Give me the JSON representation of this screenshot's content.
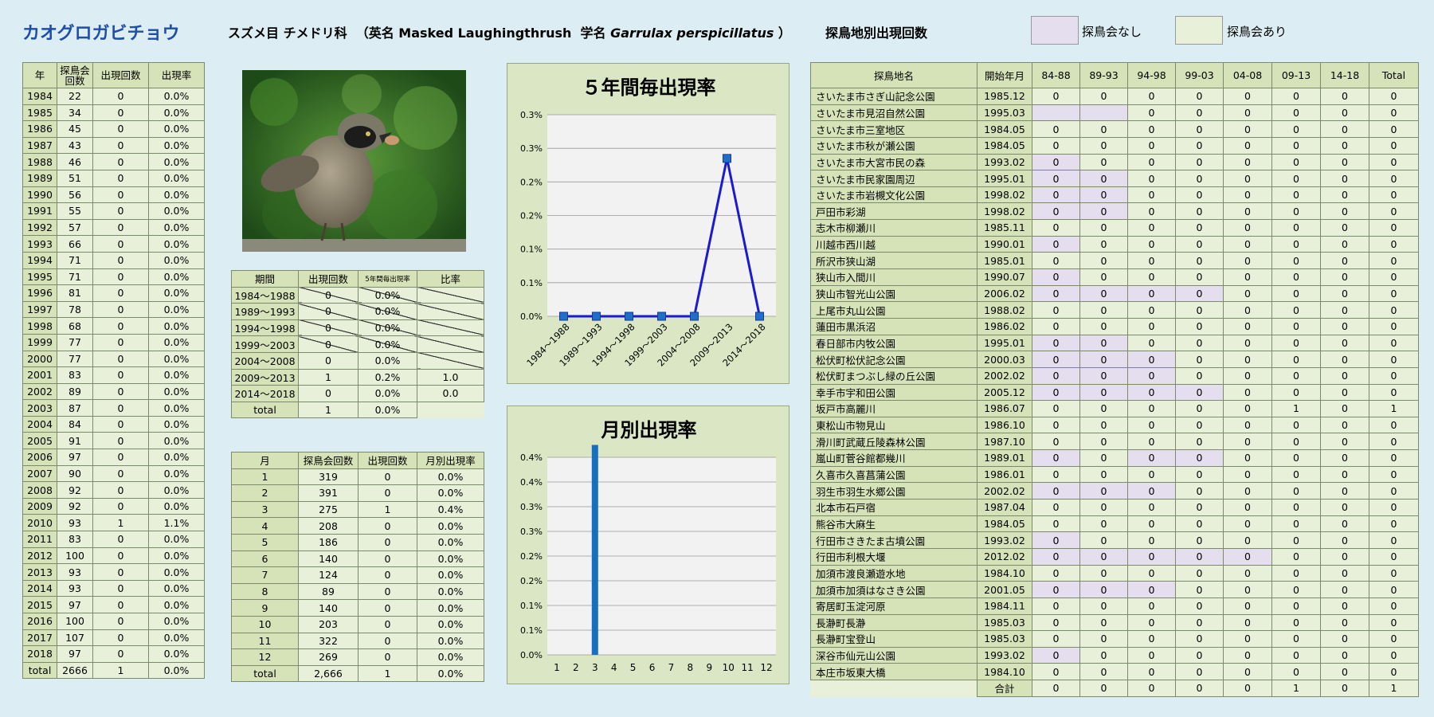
{
  "header": {
    "species_name": "カオグロガビチョウ",
    "taxon_prefix": "スズメ目 チメドリ科  （英名 Masked Laughingthrush  学名 ",
    "scientific_name": "Garrulax perspicillatus",
    "taxon_suffix": " ）",
    "location_section_title": "探鳥地別出現回数",
    "legend_none": "探鳥会なし",
    "legend_yes": "探鳥会あり",
    "legend_none_color": "#e4deef",
    "legend_yes_color": "#e8f0da"
  },
  "year_table": {
    "headers": [
      "年",
      "探鳥会\n回数",
      "出現回数",
      "出現率"
    ],
    "rows": [
      [
        "1984",
        "22",
        "0",
        "0.0%"
      ],
      [
        "1985",
        "34",
        "0",
        "0.0%"
      ],
      [
        "1986",
        "45",
        "0",
        "0.0%"
      ],
      [
        "1987",
        "43",
        "0",
        "0.0%"
      ],
      [
        "1988",
        "46",
        "0",
        "0.0%"
      ],
      [
        "1989",
        "51",
        "0",
        "0.0%"
      ],
      [
        "1990",
        "56",
        "0",
        "0.0%"
      ],
      [
        "1991",
        "55",
        "0",
        "0.0%"
      ],
      [
        "1992",
        "57",
        "0",
        "0.0%"
      ],
      [
        "1993",
        "66",
        "0",
        "0.0%"
      ],
      [
        "1994",
        "71",
        "0",
        "0.0%"
      ],
      [
        "1995",
        "71",
        "0",
        "0.0%"
      ],
      [
        "1996",
        "81",
        "0",
        "0.0%"
      ],
      [
        "1997",
        "78",
        "0",
        "0.0%"
      ],
      [
        "1998",
        "68",
        "0",
        "0.0%"
      ],
      [
        "1999",
        "77",
        "0",
        "0.0%"
      ],
      [
        "2000",
        "77",
        "0",
        "0.0%"
      ],
      [
        "2001",
        "83",
        "0",
        "0.0%"
      ],
      [
        "2002",
        "89",
        "0",
        "0.0%"
      ],
      [
        "2003",
        "87",
        "0",
        "0.0%"
      ],
      [
        "2004",
        "84",
        "0",
        "0.0%"
      ],
      [
        "2005",
        "91",
        "0",
        "0.0%"
      ],
      [
        "2006",
        "97",
        "0",
        "0.0%"
      ],
      [
        "2007",
        "90",
        "0",
        "0.0%"
      ],
      [
        "2008",
        "92",
        "0",
        "0.0%"
      ],
      [
        "2009",
        "92",
        "0",
        "0.0%"
      ],
      [
        "2010",
        "93",
        "1",
        "1.1%"
      ],
      [
        "2011",
        "83",
        "0",
        "0.0%"
      ],
      [
        "2012",
        "100",
        "0",
        "0.0%"
      ],
      [
        "2013",
        "93",
        "0",
        "0.0%"
      ],
      [
        "2014",
        "93",
        "0",
        "0.0%"
      ],
      [
        "2015",
        "97",
        "0",
        "0.0%"
      ],
      [
        "2016",
        "100",
        "0",
        "0.0%"
      ],
      [
        "2017",
        "107",
        "0",
        "0.0%"
      ],
      [
        "2018",
        "97",
        "0",
        "0.0%"
      ]
    ],
    "total": [
      "total",
      "2666",
      "1",
      "0.0%"
    ]
  },
  "period_table": {
    "headers": [
      "期間",
      "出現回数",
      "5年間毎出現率",
      "比率"
    ],
    "rows": [
      [
        "1984～1988",
        "0",
        "0.0%",
        ""
      ],
      [
        "1989～1993",
        "0",
        "0.0%",
        ""
      ],
      [
        "1994～1998",
        "0",
        "0.0%",
        ""
      ],
      [
        "1999～2003",
        "0",
        "0.0%",
        ""
      ],
      [
        "2004～2008",
        "0",
        "0.0%",
        ""
      ],
      [
        "2009～2013",
        "1",
        "0.2%",
        "1.0"
      ],
      [
        "2014～2018",
        "0",
        "0.0%",
        "0.0"
      ]
    ],
    "total": [
      "total",
      "1",
      "0.0%"
    ]
  },
  "month_table": {
    "headers": [
      "月",
      "探鳥会回数",
      "出現回数",
      "月別出現率"
    ],
    "rows": [
      [
        "1",
        "319",
        "0",
        "0.0%"
      ],
      [
        "2",
        "391",
        "0",
        "0.0%"
      ],
      [
        "3",
        "275",
        "1",
        "0.4%"
      ],
      [
        "4",
        "208",
        "0",
        "0.0%"
      ],
      [
        "5",
        "186",
        "0",
        "0.0%"
      ],
      [
        "6",
        "140",
        "0",
        "0.0%"
      ],
      [
        "7",
        "124",
        "0",
        "0.0%"
      ],
      [
        "8",
        "89",
        "0",
        "0.0%"
      ],
      [
        "9",
        "140",
        "0",
        "0.0%"
      ],
      [
        "10",
        "203",
        "0",
        "0.0%"
      ],
      [
        "11",
        "322",
        "0",
        "0.0%"
      ],
      [
        "12",
        "269",
        "0",
        "0.0%"
      ]
    ],
    "total": [
      "total",
      "2,666",
      "1",
      "0.0%"
    ]
  },
  "loc_table": {
    "headers": [
      "探鳥地名",
      "開始年月",
      "84-88",
      "89-93",
      "94-98",
      "99-03",
      "04-08",
      "09-13",
      "14-18",
      "Total"
    ],
    "rows": [
      {
        "name": "さいたま市さぎ山記念公園",
        "start": "1985.12",
        "v": [
          "0",
          "0",
          "0",
          "0",
          "0",
          "0",
          "0",
          "0"
        ],
        "none": []
      },
      {
        "name": "さいたま市見沼自然公園",
        "start": "1995.03",
        "v": [
          "",
          "",
          "0",
          "0",
          "0",
          "0",
          "0",
          "0"
        ],
        "none": [
          0,
          1
        ]
      },
      {
        "name": "さいたま市三室地区",
        "start": "1984.05",
        "v": [
          "0",
          "0",
          "0",
          "0",
          "0",
          "0",
          "0",
          "0"
        ],
        "none": []
      },
      {
        "name": "さいたま市秋が瀬公園",
        "start": "1984.05",
        "v": [
          "0",
          "0",
          "0",
          "0",
          "0",
          "0",
          "0",
          "0"
        ],
        "none": []
      },
      {
        "name": "さいたま市大宮市民の森",
        "start": "1993.02",
        "v": [
          "0",
          "0",
          "0",
          "0",
          "0",
          "0",
          "0",
          "0"
        ],
        "none": [
          0
        ]
      },
      {
        "name": "さいたま市民家園周辺",
        "start": "1995.01",
        "v": [
          "0",
          "0",
          "0",
          "0",
          "0",
          "0",
          "0",
          "0"
        ],
        "none": [
          0,
          1
        ]
      },
      {
        "name": "さいたま市岩槻文化公園",
        "start": "1998.02",
        "v": [
          "0",
          "0",
          "0",
          "0",
          "0",
          "0",
          "0",
          "0"
        ],
        "none": [
          0,
          1
        ]
      },
      {
        "name": "戸田市彩湖",
        "start": "1998.02",
        "v": [
          "0",
          "0",
          "0",
          "0",
          "0",
          "0",
          "0",
          "0"
        ],
        "none": [
          0,
          1
        ]
      },
      {
        "name": "志木市柳瀬川",
        "start": "1985.11",
        "v": [
          "0",
          "0",
          "0",
          "0",
          "0",
          "0",
          "0",
          "0"
        ],
        "none": []
      },
      {
        "name": "川越市西川越",
        "start": "1990.01",
        "v": [
          "0",
          "0",
          "0",
          "0",
          "0",
          "0",
          "0",
          "0"
        ],
        "none": [
          0
        ]
      },
      {
        "name": "所沢市狭山湖",
        "start": "1985.01",
        "v": [
          "0",
          "0",
          "0",
          "0",
          "0",
          "0",
          "0",
          "0"
        ],
        "none": []
      },
      {
        "name": "狭山市入間川",
        "start": "1990.07",
        "v": [
          "0",
          "0",
          "0",
          "0",
          "0",
          "0",
          "0",
          "0"
        ],
        "none": [
          0
        ]
      },
      {
        "name": "狭山市智光山公園",
        "start": "2006.02",
        "v": [
          "0",
          "0",
          "0",
          "0",
          "0",
          "0",
          "0",
          "0"
        ],
        "none": [
          0,
          1,
          2,
          3
        ]
      },
      {
        "name": "上尾市丸山公園",
        "start": "1988.02",
        "v": [
          "0",
          "0",
          "0",
          "0",
          "0",
          "0",
          "0",
          "0"
        ],
        "none": []
      },
      {
        "name": "蓮田市黒浜沼",
        "start": "1986.02",
        "v": [
          "0",
          "0",
          "0",
          "0",
          "0",
          "0",
          "0",
          "0"
        ],
        "none": []
      },
      {
        "name": "春日部市内牧公園",
        "start": "1995.01",
        "v": [
          "0",
          "0",
          "0",
          "0",
          "0",
          "0",
          "0",
          "0"
        ],
        "none": [
          0,
          1
        ]
      },
      {
        "name": "松伏町松伏記念公園",
        "start": "2000.03",
        "v": [
          "0",
          "0",
          "0",
          "0",
          "0",
          "0",
          "0",
          "0"
        ],
        "none": [
          0,
          1,
          2
        ]
      },
      {
        "name": "松伏町まつぶし緑の丘公園",
        "start": "2002.02",
        "v": [
          "0",
          "0",
          "0",
          "0",
          "0",
          "0",
          "0",
          "0"
        ],
        "none": [
          0,
          1,
          2
        ]
      },
      {
        "name": "幸手市宇和田公園",
        "start": "2005.12",
        "v": [
          "0",
          "0",
          "0",
          "0",
          "0",
          "0",
          "0",
          "0"
        ],
        "none": [
          0,
          1,
          2,
          3
        ]
      },
      {
        "name": "坂戸市高麗川",
        "start": "1986.07",
        "v": [
          "0",
          "0",
          "0",
          "0",
          "0",
          "1",
          "0",
          "1"
        ],
        "none": []
      },
      {
        "name": "東松山市物見山",
        "start": "1986.10",
        "v": [
          "0",
          "0",
          "0",
          "0",
          "0",
          "0",
          "0",
          "0"
        ],
        "none": []
      },
      {
        "name": "滑川町武蔵丘陵森林公園",
        "start": "1987.10",
        "v": [
          "0",
          "0",
          "0",
          "0",
          "0",
          "0",
          "0",
          "0"
        ],
        "none": []
      },
      {
        "name": "嵐山町菅谷館都幾川",
        "start": "1989.01",
        "v": [
          "0",
          "0",
          "0",
          "0",
          "0",
          "0",
          "0",
          "0"
        ],
        "none": [
          0,
          2,
          3
        ]
      },
      {
        "name": "久喜市久喜菖蒲公園",
        "start": "1986.01",
        "v": [
          "0",
          "0",
          "0",
          "0",
          "0",
          "0",
          "0",
          "0"
        ],
        "none": []
      },
      {
        "name": "羽生市羽生水郷公園",
        "start": "2002.02",
        "v": [
          "0",
          "0",
          "0",
          "0",
          "0",
          "0",
          "0",
          "0"
        ],
        "none": [
          0,
          1,
          2
        ]
      },
      {
        "name": "北本市石戸宿",
        "start": "1987.04",
        "v": [
          "0",
          "0",
          "0",
          "0",
          "0",
          "0",
          "0",
          "0"
        ],
        "none": []
      },
      {
        "name": "熊谷市大麻生",
        "start": "1984.05",
        "v": [
          "0",
          "0",
          "0",
          "0",
          "0",
          "0",
          "0",
          "0"
        ],
        "none": []
      },
      {
        "name": "行田市さきたま古墳公園",
        "start": "1993.02",
        "v": [
          "0",
          "0",
          "0",
          "0",
          "0",
          "0",
          "0",
          "0"
        ],
        "none": [
          0
        ]
      },
      {
        "name": "行田市利根大堰",
        "start": "2012.02",
        "v": [
          "0",
          "0",
          "0",
          "0",
          "0",
          "0",
          "0",
          "0"
        ],
        "none": [
          0,
          1,
          2,
          3,
          4
        ]
      },
      {
        "name": "加須市渡良瀬遊水地",
        "start": "1984.10",
        "v": [
          "0",
          "0",
          "0",
          "0",
          "0",
          "0",
          "0",
          "0"
        ],
        "none": []
      },
      {
        "name": "加須市加須はなさき公園",
        "start": "2001.05",
        "v": [
          "0",
          "0",
          "0",
          "0",
          "0",
          "0",
          "0",
          "0"
        ],
        "none": [
          0,
          1,
          2
        ]
      },
      {
        "name": "寄居町玉淀河原",
        "start": "1984.11",
        "v": [
          "0",
          "0",
          "0",
          "0",
          "0",
          "0",
          "0",
          "0"
        ],
        "none": []
      },
      {
        "name": "長瀞町長瀞",
        "start": "1985.03",
        "v": [
          "0",
          "0",
          "0",
          "0",
          "0",
          "0",
          "0",
          "0"
        ],
        "none": []
      },
      {
        "name": "長瀞町宝登山",
        "start": "1985.03",
        "v": [
          "0",
          "0",
          "0",
          "0",
          "0",
          "0",
          "0",
          "0"
        ],
        "none": []
      },
      {
        "name": "深谷市仙元山公園",
        "start": "1993.02",
        "v": [
          "0",
          "0",
          "0",
          "0",
          "0",
          "0",
          "0",
          "0"
        ],
        "none": [
          0
        ]
      },
      {
        "name": "本庄市坂東大橋",
        "start": "1984.10",
        "v": [
          "0",
          "0",
          "0",
          "0",
          "0",
          "0",
          "0",
          "0"
        ],
        "none": []
      }
    ],
    "total_label": "合計",
    "total": [
      "0",
      "0",
      "0",
      "0",
      "0",
      "1",
      "0",
      "1"
    ]
  },
  "chart_data": [
    {
      "type": "line",
      "title": "５年間毎出現率",
      "categories": [
        "1984～1988",
        "1989～1993",
        "1994～1998",
        "1999～2003",
        "2004～2008",
        "2009～2013",
        "2014～2018"
      ],
      "values": [
        0.0,
        0.0,
        0.0,
        0.0,
        0.0,
        0.235,
        0.0
      ],
      "ylim": [
        0,
        0.3
      ],
      "yticks": [
        "0.0%",
        "0.1%",
        "0.1%",
        "0.2%",
        "0.2%",
        "0.3%",
        "0.3%"
      ],
      "ytick_values": [
        0,
        0.05,
        0.1,
        0.15,
        0.2,
        0.25,
        0.3
      ],
      "line_color": "#1a1ad0",
      "marker_color": "#1f6fc8",
      "grid": true
    },
    {
      "type": "bar",
      "title": "月別出現率",
      "categories": [
        "1",
        "2",
        "3",
        "4",
        "5",
        "6",
        "7",
        "8",
        "9",
        "10",
        "11",
        "12"
      ],
      "values": [
        0,
        0,
        0.425,
        0,
        0,
        0,
        0,
        0,
        0,
        0,
        0,
        0
      ],
      "ylim": [
        0,
        0.4
      ],
      "yticks": [
        "0.0%",
        "0.1%",
        "0.1%",
        "0.2%",
        "0.2%",
        "0.3%",
        "0.3%",
        "0.4%",
        "0.4%"
      ],
      "ytick_values": [
        0,
        0.05,
        0.1,
        0.15,
        0.2,
        0.25,
        0.3,
        0.35,
        0.4
      ],
      "bar_color": "#1670c0",
      "grid": true
    }
  ]
}
